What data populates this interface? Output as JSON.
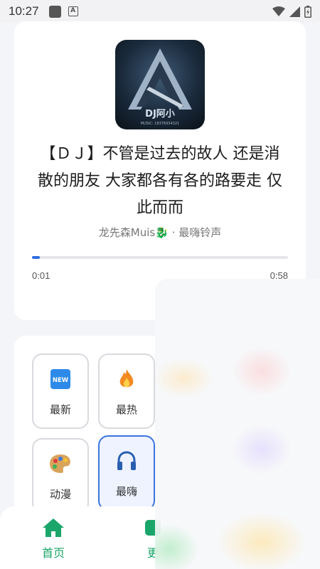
{
  "status_bar": {
    "time": "10:27"
  },
  "player": {
    "cover_text": "DJ阿小",
    "cover_subtext": "MUSIC: 18376934321",
    "title": "【ＤＪ】不管是过去的故人 还是消散的朋友 大家都各有各的路要走 仅此而而",
    "artist": "龙先森Muis🐉",
    "separator": " · ",
    "category": "最嗨铃声",
    "current_time": "0:01",
    "total_time": "0:58",
    "progress": 0.03
  },
  "categories": [
    {
      "label": "最新",
      "icon": "new-icon"
    },
    {
      "label": "最热",
      "icon": "fire-icon"
    },
    {
      "label": "动漫",
      "icon": "palette-icon"
    },
    {
      "label": "最嗨",
      "icon": "headphones-icon",
      "active": true
    }
  ],
  "tabbar": {
    "tabs": [
      {
        "label": "首页",
        "icon": "home-icon",
        "active": true
      },
      {
        "label": "更",
        "icon": "more-icon"
      }
    ]
  },
  "colors": {
    "accent": "#2f6fe0",
    "tab_active": "#1aa56a"
  }
}
